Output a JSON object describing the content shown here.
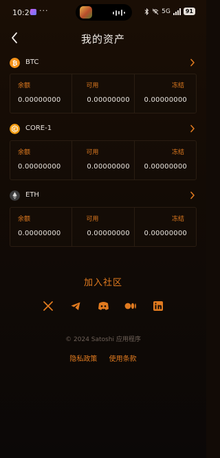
{
  "status_bar": {
    "time": "10:26",
    "battery": "91",
    "network": "5G"
  },
  "header": {
    "title": "我的资产",
    "back_icon": "chevron-left-icon"
  },
  "labels": {
    "balance": "余额",
    "available": "可用",
    "frozen": "冻结"
  },
  "assets": [
    {
      "name": "BTC",
      "icon": "bitcoin-icon",
      "icon_color": "#f7931a",
      "balance": "0.00000000",
      "available": "0.00000000",
      "frozen": "0.00000000"
    },
    {
      "name": "CORE-1",
      "icon": "core-icon",
      "icon_color": "#f39c12",
      "balance": "0.00000000",
      "available": "0.00000000",
      "frozen": "0.00000000"
    },
    {
      "name": "ETH",
      "icon": "ethereum-icon",
      "icon_color": "#3c3c3d",
      "balance": "0.00000000",
      "available": "0.00000000",
      "frozen": "0.00000000"
    }
  ],
  "community": {
    "title": "加入社区",
    "socials": [
      "x-icon",
      "telegram-icon",
      "discord-icon",
      "medium-icon",
      "linkedin-icon"
    ]
  },
  "footer": {
    "copyright": "© 2024 Satoshi 应用程序",
    "privacy": "隐私政策",
    "terms": "使用条款"
  },
  "colors": {
    "accent": "#e07a1f",
    "background": "#120b06",
    "card_border": "#2a1d12"
  }
}
